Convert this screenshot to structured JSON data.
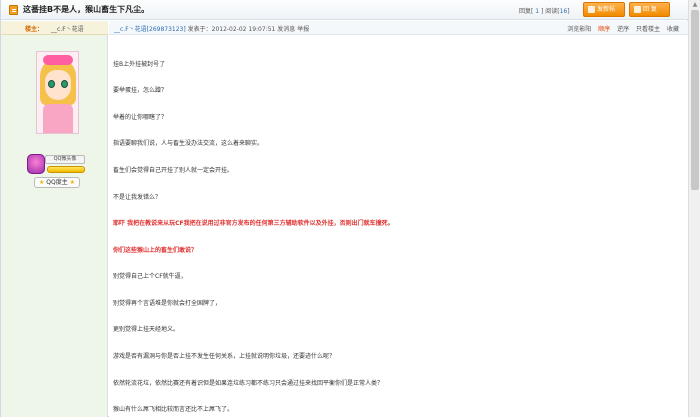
{
  "header": {
    "title": "这番挂B不是人，猴山畜生下凡尘。",
    "stats_reply_label": "回复",
    "stats_reply_count": "1",
    "stats_view_label": "阅读",
    "stats_view_count": "16",
    "new_post_label": "发新帖",
    "reply_label": "回 复"
  },
  "sidebar": {
    "owner_label": "楼主：",
    "owner_name": "__c.F丶花语",
    "badge_text": "QQ微头像",
    "rank_label": "QQ度主"
  },
  "post": {
    "meta_author": "__c.F丶花语[269873123]",
    "meta_time": "发表于：2012-02-02 19:07:51",
    "meta_pm": "发消息",
    "meta_report": "举报",
    "view_mode_label": "浏览影阳",
    "order_asc": "顺序",
    "order_desc": "逆序",
    "only_owner": "只看楼主",
    "favorite": "收藏",
    "paragraphs": [
      "挂B上外挂被封号了",
      "要举蛋挂，怎么蹭？",
      "举着的让你哪瞎了？",
      "指语要聊我们说，人与畜生没办法交流，这么着来聊实。",
      "畜生们会觉得自己开挂了别人就一定会开挂。",
      "不是让我发错么？",
      "耶吓 我把在教说来从玩CF我把在说用过非官方发布的任何第三方辅助软件以及外挂，否则出门就车撞死。",
      "你们这些猴山上的畜生们敢说？",
      "别觉得自己上个CF就牛逼，",
      "别觉得再个言语堆是你就会打全国牌了，",
      "更别觉得上挂天经地义。",
      "游戏是否有漏洞与你是否上挂不发生任何关系，上挂就说明你垃圾，还要迹什么呢？",
      "依然轮流花垃，依然比赛还有着识但是如果连垃练习都不练习只会通过挂来找回平衡你们是正常人类？",
      "猴山有什么屌飞相比较而言还比不上屌飞了。"
    ]
  },
  "colors": {
    "accent_orange": "#f08a00",
    "link_blue": "#2a6db5",
    "warning_red": "#e03030",
    "sidebar_green": "#eef6e9"
  }
}
